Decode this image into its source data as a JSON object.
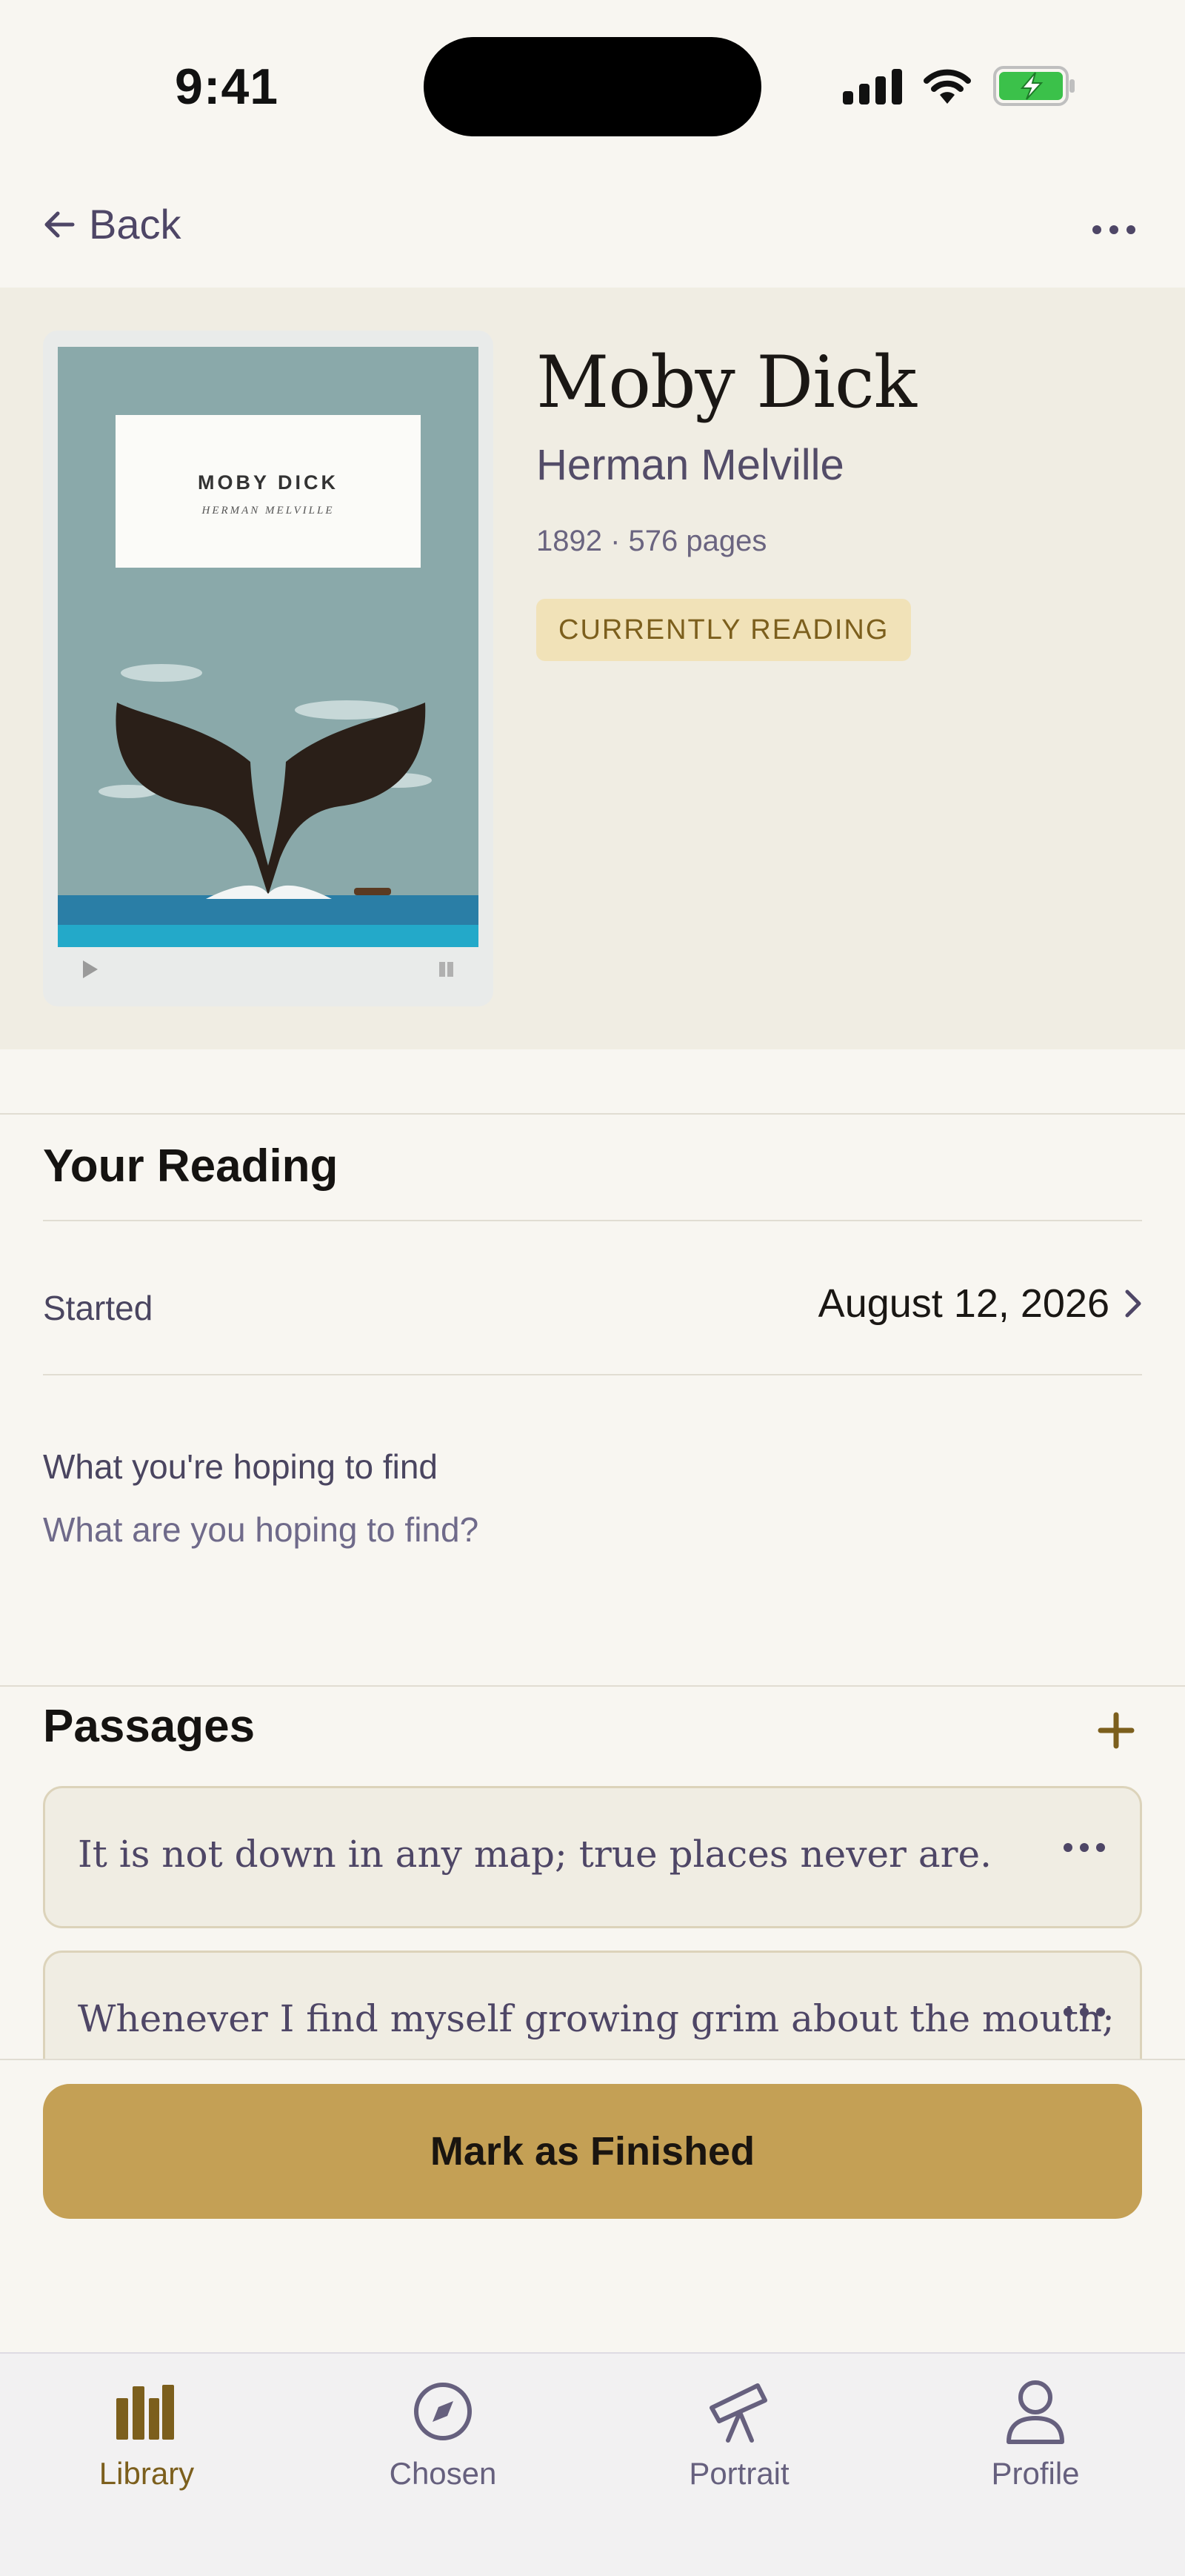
{
  "status_bar": {
    "time": "9:41"
  },
  "nav": {
    "back_label": "Back"
  },
  "book": {
    "title": "Moby Dick",
    "author": "Herman Melville",
    "meta": "1892 · 576 pages",
    "status": "CURRENTLY READING",
    "cover": {
      "title": "MOBY DICK",
      "author": "HERMAN MELVILLE"
    }
  },
  "reading": {
    "section_title": "Your Reading",
    "started_label": "Started",
    "started_value": "August 12, 2026",
    "hope_label": "What you're hoping to find",
    "hope_placeholder": "What are you hoping to find?",
    "hope_value": ""
  },
  "passages": {
    "section_title": "Passages",
    "items": [
      {
        "text": "It is not down in any map; true places never are."
      },
      {
        "text": "Whenever I find myself growing grim about the mouth;"
      }
    ]
  },
  "actions": {
    "finish_label": "Mark as Finished"
  },
  "tabs": [
    {
      "label": "Library",
      "icon": "library-icon",
      "active": true
    },
    {
      "label": "Chosen",
      "icon": "compass-icon",
      "active": false
    },
    {
      "label": "Portrait",
      "icon": "telescope-icon",
      "active": false
    },
    {
      "label": "Profile",
      "icon": "person-icon",
      "active": false
    }
  ],
  "colors": {
    "accent": "#c4a055",
    "accent_text": "#7c5f1d",
    "badge_bg": "#f1e2b8",
    "muted_purple": "#4e4666",
    "background": "#f8f6f1",
    "hero_bg": "#f0ede3"
  }
}
